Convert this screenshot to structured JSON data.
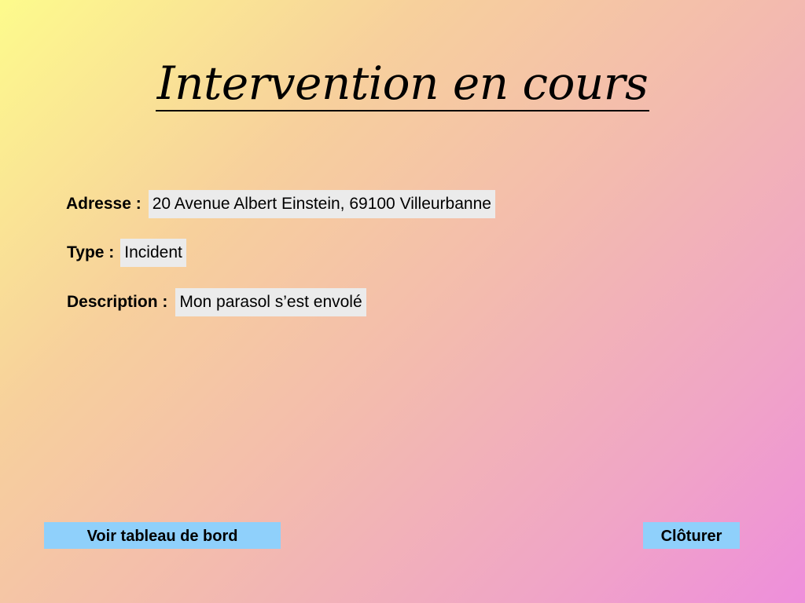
{
  "header": {
    "title": "Intervention en cours"
  },
  "details": {
    "address": {
      "label": "Adresse :",
      "value": "20 Avenue Albert Einstein, 69100 Villeurbanne"
    },
    "type": {
      "label": "Type :",
      "value": "Incident"
    },
    "description": {
      "label": "Description :",
      "value": "Mon parasol s’est envolé"
    }
  },
  "actions": {
    "dashboard_label": "Voir tableau de bord",
    "close_label": "Clôturer"
  },
  "colors": {
    "button_background": "#8fd0fb",
    "field_background": "#ebebeb",
    "gradient_start": "#fdfb8c",
    "gradient_end": "#ee8edb"
  }
}
